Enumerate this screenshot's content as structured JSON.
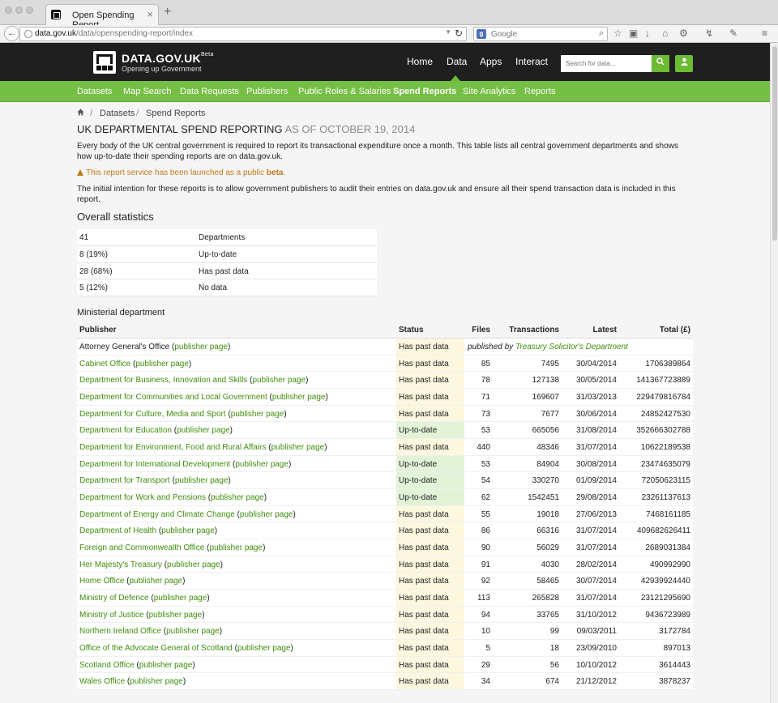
{
  "browser": {
    "tab_title": "Open Spending Report",
    "url_host": "data.gov.uk",
    "url_path": "/data/openspending-report/index",
    "search_engine": "Google"
  },
  "site": {
    "logo_name": "DATA.GOV.UK",
    "logo_badge": "Beta",
    "logo_tagline": "Opening up Government",
    "top_nav": [
      "Home",
      "Data",
      "Apps",
      "Interact"
    ],
    "search_placeholder": "Search for data...",
    "sub_nav": [
      "Datasets",
      "Map Search",
      "Data Requests",
      "Publishers",
      "Public Roles & Salaries",
      "Spend Reports",
      "Site Analytics",
      "Reports"
    ],
    "brand_green": "#76bf45",
    "link_green": "#3f8e0d"
  },
  "breadcrumb": [
    "Datasets",
    "Spend Reports"
  ],
  "page": {
    "title": "UK Departmental Spend Reporting",
    "asof": "as of October 19, 2014",
    "intro": "Every body of the UK central government is required to report its transactional expenditure once a month. This table lists all central government departments and shows how up-to-date their spending reports are on data.gov.uk.",
    "warning_text": "This report service has been launched as a public",
    "warning_bold": "beta",
    "warning_end": ".",
    "intention": "The initial intention for these reports is to allow government publishers to audit their entries on data.gov.uk and ensure all their spend transaction data is included in this report."
  },
  "stats": {
    "heading": "Overall statistics",
    "rows": [
      {
        "value": "41",
        "label": "Departments"
      },
      {
        "value": "8 (19%)",
        "label": "Up-to-date"
      },
      {
        "value": "28 (68%)",
        "label": "Has past data"
      },
      {
        "value": "5 (12%)",
        "label": "No data"
      }
    ]
  },
  "ministerial": {
    "heading": "Ministerial department",
    "columns": [
      "Publisher",
      "Status",
      "Files",
      "Transactions",
      "Latest",
      "Total (£)"
    ],
    "publisher_page_label": "publisher page",
    "rows": [
      {
        "name": "Attorney General's Office",
        "name_link": false,
        "status": "Has past data",
        "note_prefix": "published by",
        "note_link": "Treasury Solicitor's Department",
        "files": "",
        "transactions": "",
        "latest": "",
        "total": ""
      },
      {
        "name": "Cabinet Office",
        "name_link": true,
        "status": "Has past data",
        "files": "85",
        "transactions": "7495",
        "latest": "30/04/2014",
        "total": "1706389864"
      },
      {
        "name": "Department for Business, Innovation and Skills",
        "name_link": true,
        "status": "Has past data",
        "files": "78",
        "transactions": "127138",
        "latest": "30/05/2014",
        "total": "141367723889"
      },
      {
        "name": "Department for Communities and Local Government",
        "name_link": true,
        "status": "Has past data",
        "files": "71",
        "transactions": "169607",
        "latest": "31/03/2013",
        "total": "229479816784"
      },
      {
        "name": "Department for Culture, Media and Sport",
        "name_link": true,
        "status": "Has past data",
        "files": "73",
        "transactions": "7677",
        "latest": "30/06/2014",
        "total": "24852427530"
      },
      {
        "name": "Department for Education",
        "name_link": true,
        "status": "Up-to-date",
        "files": "53",
        "transactions": "665056",
        "latest": "31/08/2014",
        "total": "352666302788"
      },
      {
        "name": "Department for Environment, Food and Rural Affairs",
        "name_link": true,
        "status": "Has past data",
        "files": "440",
        "transactions": "48346",
        "latest": "31/07/2014",
        "total": "10622189538"
      },
      {
        "name": "Department for International Development",
        "name_link": true,
        "status": "Up-to-date",
        "files": "53",
        "transactions": "84904",
        "latest": "30/08/2014",
        "total": "23474635079"
      },
      {
        "name": "Department for Transport",
        "name_link": true,
        "status": "Up-to-date",
        "files": "54",
        "transactions": "330270",
        "latest": "01/09/2014",
        "total": "72050623115"
      },
      {
        "name": "Department for Work and Pensions",
        "name_link": true,
        "status": "Up-to-date",
        "files": "62",
        "transactions": "1542451",
        "latest": "29/08/2014",
        "total": "23261137613"
      },
      {
        "name": "Department of Energy and Climate Change",
        "name_link": true,
        "status": "Has past data",
        "files": "55",
        "transactions": "19018",
        "latest": "27/06/2013",
        "total": "7468161185"
      },
      {
        "name": "Department of Health",
        "name_link": true,
        "status": "Has past data",
        "files": "86",
        "transactions": "66316",
        "latest": "31/07/2014",
        "total": "409682626411"
      },
      {
        "name": "Foreign and Commonwealth Office",
        "name_link": true,
        "status": "Has past data",
        "files": "90",
        "transactions": "56029",
        "latest": "31/07/2014",
        "total": "2689031384"
      },
      {
        "name": "Her Majesty's Treasury",
        "name_link": true,
        "status": "Has past data",
        "files": "91",
        "transactions": "4030",
        "latest": "28/02/2014",
        "total": "490992990"
      },
      {
        "name": "Home Office",
        "name_link": true,
        "status": "Has past data",
        "files": "92",
        "transactions": "58465",
        "latest": "30/07/2014",
        "total": "42939924440"
      },
      {
        "name": "Ministry of Defence",
        "name_link": true,
        "status": "Has past data",
        "files": "113",
        "transactions": "265828",
        "latest": "31/07/2014",
        "total": "23121295690"
      },
      {
        "name": "Ministry of Justice",
        "name_link": true,
        "status": "Has past data",
        "files": "94",
        "transactions": "33765",
        "latest": "31/10/2012",
        "total": "9436723989"
      },
      {
        "name": "Northern Ireland Office",
        "name_link": true,
        "status": "Has past data",
        "files": "10",
        "transactions": "99",
        "latest": "09/03/2011",
        "total": "3172784"
      },
      {
        "name": "Office of the Advocate General of Scotland",
        "name_link": true,
        "status": "Has past data",
        "files": "5",
        "transactions": "18",
        "latest": "23/09/2010",
        "total": "897013"
      },
      {
        "name": "Scotland Office",
        "name_link": true,
        "status": "Has past data",
        "files": "29",
        "transactions": "56",
        "latest": "10/10/2012",
        "total": "3614443"
      },
      {
        "name": "Wales Office",
        "name_link": true,
        "status": "Has past data",
        "files": "34",
        "transactions": "674",
        "latest": "21/12/2012",
        "total": "3878237"
      }
    ]
  }
}
